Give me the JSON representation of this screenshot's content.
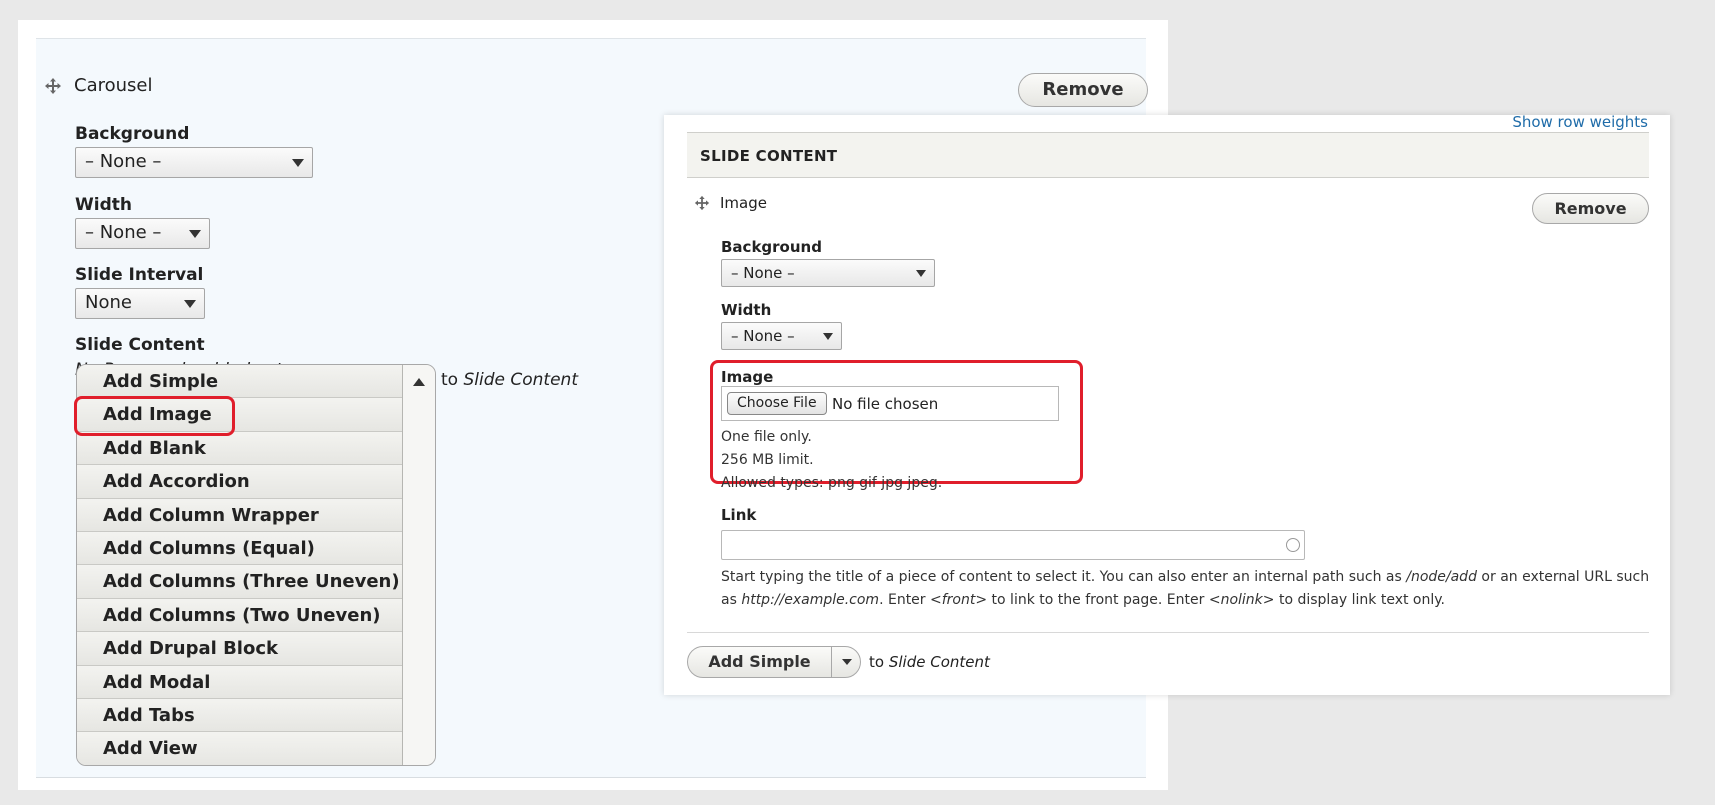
{
  "carousel": {
    "title": "Carousel",
    "remove_label": "Remove",
    "background": {
      "label": "Background",
      "value": "– None –"
    },
    "width": {
      "label": "Width",
      "value": "– None –"
    },
    "slide_interval": {
      "label": "Slide Interval",
      "value": "None"
    },
    "slide_content": {
      "label": "Slide Content",
      "empty_message": "No Paragraph added yet.",
      "to_prefix": "to",
      "to_target": "Slide Content",
      "add_options": [
        "Add Simple",
        "Add Image",
        "Add Blank",
        "Add Accordion",
        "Add Column Wrapper",
        "Add Columns (Equal)",
        "Add Columns (Three Uneven)",
        "Add Columns (Two Uneven)",
        "Add Drupal Block",
        "Add Modal",
        "Add Tabs",
        "Add View"
      ]
    }
  },
  "slide_panel": {
    "show_row_weights": "Show row weights",
    "section_title": "SLIDE CONTENT",
    "image_paragraph": {
      "title": "Image",
      "remove_label": "Remove",
      "background": {
        "label": "Background",
        "value": "– None –"
      },
      "width": {
        "label": "Width",
        "value": "– None –"
      },
      "image_field": {
        "label": "Image",
        "choose_file": "Choose File",
        "no_file": "No file chosen",
        "help_1": "One file only.",
        "help_2": "256 MB limit.",
        "help_3": "Allowed types: png gif jpg jpeg."
      },
      "link": {
        "label": "Link",
        "value": "",
        "help_a": "Start typing the title of a piece of content to select it. You can also enter an internal path such as ",
        "help_path": "/node/add",
        "help_b": " or an external URL such",
        "help_c": "as ",
        "help_url": "http://example.com",
        "help_d": ". Enter ",
        "help_front": "<front>",
        "help_e": " to link to the front page. Enter ",
        "help_nolink": "<nolink>",
        "help_f": " to display link text only."
      }
    },
    "add_simple": {
      "label": "Add Simple",
      "to_prefix": "to",
      "to_target": "Slide Content"
    }
  },
  "colors": {
    "highlight": "#e01e2b",
    "link": "#1f6ca9",
    "panel_bg": "#f4f9fd"
  }
}
